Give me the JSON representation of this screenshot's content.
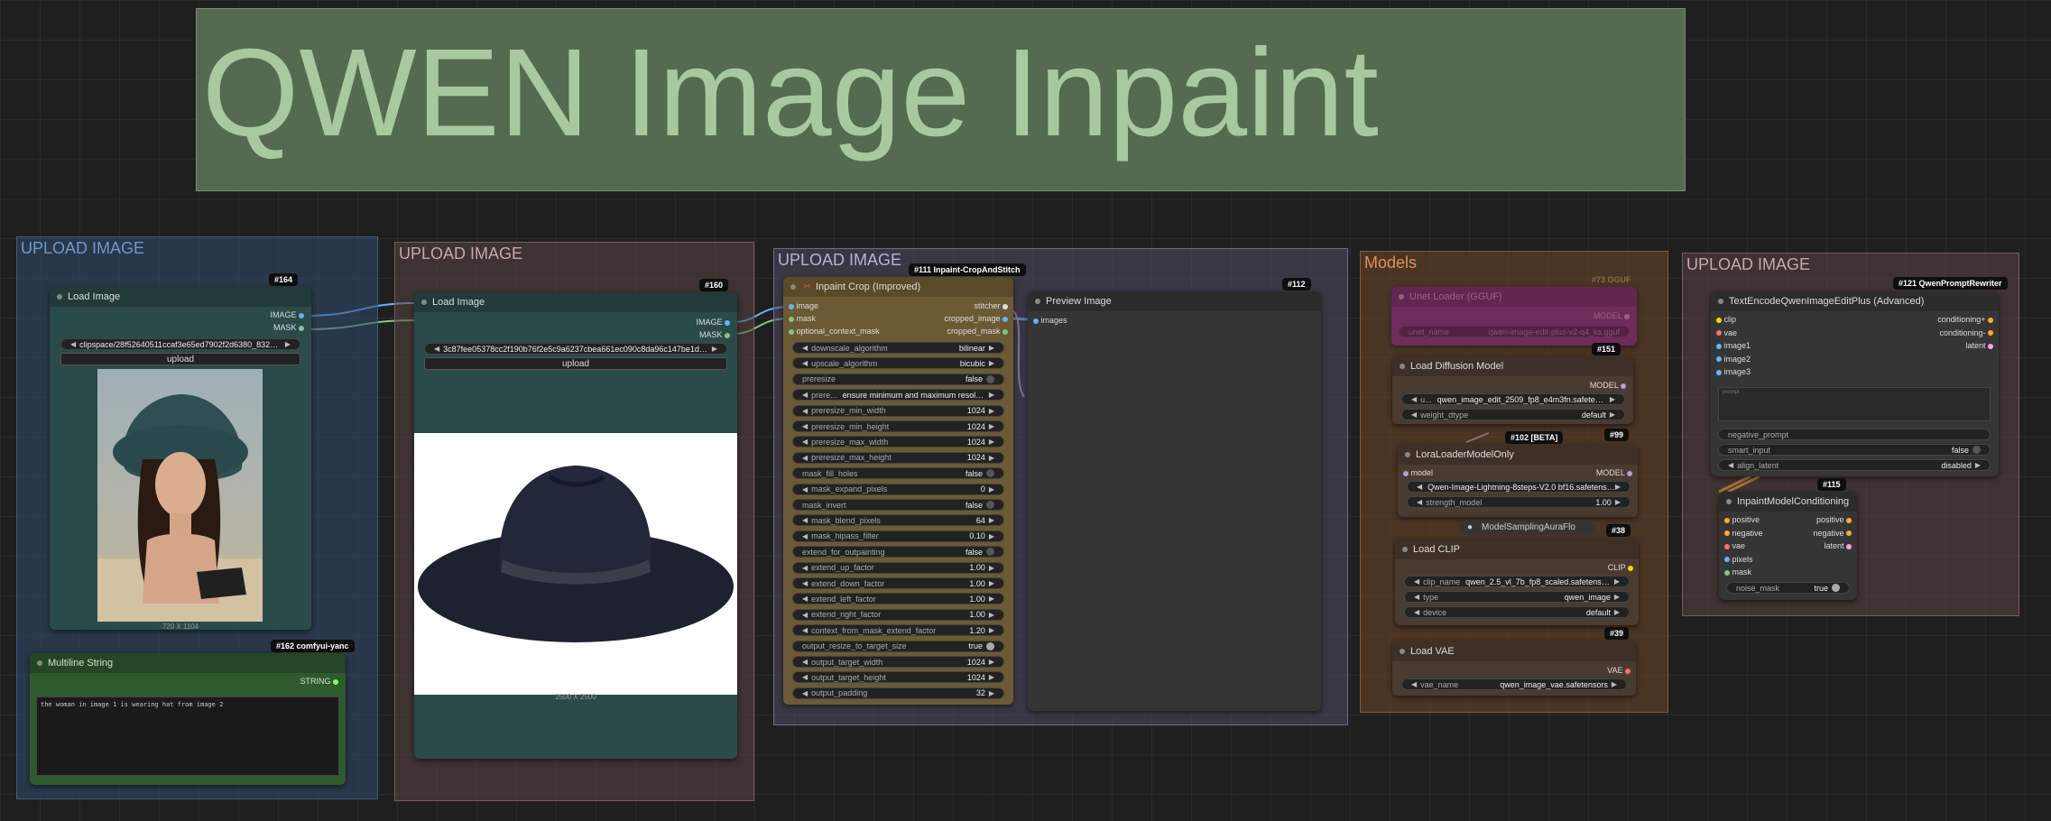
{
  "title_note": "QWEN Image Inpaint",
  "groups": {
    "g1": "UPLOAD IMAGE",
    "g2": "UPLOAD IMAGE",
    "g3": "UPLOAD IMAGE",
    "g4": "Models",
    "g5": "UPLOAD IMAGE"
  },
  "load_image_1": {
    "id": "#164",
    "title": "Load Image",
    "out_image": "IMAGE",
    "out_mask": "MASK",
    "file": "clipspace/28f52640511ccaf3e65ed7902f2d6380_8327c4 ...",
    "upload": "upload",
    "dims": "720 X 1104"
  },
  "multiline": {
    "id": "#162 comfyui-yanc",
    "title": "Multiline String",
    "out": "STRING",
    "text": "the woman in image 1 is wearing hat from image 2"
  },
  "load_image_2": {
    "id": "#160",
    "title": "Load Image",
    "out_image": "IMAGE",
    "out_mask": "MASK",
    "file": "3c87fee05378cc2f190b76f2e5c9a6237cbea661ec090c8da96c147be1d30d ...",
    "upload": "upload",
    "dims": "2500 X 2500"
  },
  "inpaint_crop": {
    "id": "#111 Inpaint-CropAndStitch",
    "title": "Inpaint Crop (Improved)",
    "in_image": "image",
    "in_mask": "mask",
    "in_ctx": "optional_context_mask",
    "out_stitcher": "stitcher",
    "out_cropped_image": "cropped_image",
    "out_cropped_mask": "cropped_mask",
    "widgets": [
      {
        "label": "downscale_algorithm",
        "value": "bilinear",
        "kind": "combo"
      },
      {
        "label": "upscale_algorithm",
        "value": "bicubic",
        "kind": "combo"
      },
      {
        "label": "preresize",
        "value": "false",
        "kind": "toggle"
      },
      {
        "label": "prere...",
        "value": "ensure minimum and maximum resolution",
        "kind": "combo"
      },
      {
        "label": "preresize_min_width",
        "value": "1024",
        "kind": "number"
      },
      {
        "label": "preresize_min_height",
        "value": "1024",
        "kind": "number"
      },
      {
        "label": "preresize_max_width",
        "value": "1024",
        "kind": "number"
      },
      {
        "label": "preresize_max_height",
        "value": "1024",
        "kind": "number"
      },
      {
        "label": "mask_fill_holes",
        "value": "false",
        "kind": "toggle"
      },
      {
        "label": "mask_expand_pixels",
        "value": "0",
        "kind": "number"
      },
      {
        "label": "mask_invert",
        "value": "false",
        "kind": "toggle"
      },
      {
        "label": "mask_blend_pixels",
        "value": "64",
        "kind": "number"
      },
      {
        "label": "mask_hipass_filter",
        "value": "0.10",
        "kind": "number"
      },
      {
        "label": "extend_for_outpainting",
        "value": "false",
        "kind": "toggle"
      },
      {
        "label": "extend_up_factor",
        "value": "1.00",
        "kind": "number"
      },
      {
        "label": "extend_down_factor",
        "value": "1.00",
        "kind": "number"
      },
      {
        "label": "extend_left_factor",
        "value": "1.00",
        "kind": "number"
      },
      {
        "label": "extend_right_factor",
        "value": "1.00",
        "kind": "number"
      },
      {
        "label": "context_from_mask_extend_factor",
        "value": "1.20",
        "kind": "number"
      },
      {
        "label": "output_resize_to_target_size",
        "value": "true",
        "kind": "toggle-on"
      },
      {
        "label": "output_target_width",
        "value": "1024",
        "kind": "number"
      },
      {
        "label": "output_target_height",
        "value": "1024",
        "kind": "number"
      },
      {
        "label": "output_padding",
        "value": "32",
        "kind": "number"
      }
    ]
  },
  "preview": {
    "id": "#112",
    "title": "Preview Image",
    "in_images": "images"
  },
  "unet_loader": {
    "id": "#73 GGUF",
    "title": "Unet Loader (GGUF)",
    "out": "MODEL",
    "w_label": "unet_name",
    "w_value": "qwen-image-edit-plus-v2-q4_ks.gguf"
  },
  "load_diffusion": {
    "id": "#151",
    "title": "Load Diffusion Model",
    "out": "MODEL",
    "w1_label": "u...",
    "w1_value": "qwen_image_edit_2509_fp8_e4m3fn.safetensors",
    "w2_label": "weight_dtype",
    "w2_value": "default"
  },
  "lora": {
    "id_beta": "#102 [BETA]",
    "id": "#99",
    "title": "LoraLoaderModelOnly",
    "in_model": "model",
    "out": "MODEL",
    "w1_value": "Qwen-Image-Lightning-8steps-V2.0 bf16.safetensors",
    "w2_label": "strength_model",
    "w2_value": "1.00"
  },
  "aura": {
    "title": "ModelSamplingAuraFlo",
    "id": "#38"
  },
  "load_clip": {
    "title": "Load CLIP",
    "out": "CLIP",
    "w1_label": "clip_name",
    "w1_value": "qwen_2.5_vl_7b_fp8_scaled.safetensors",
    "w2_label": "type",
    "w2_value": "qwen_image",
    "w3_label": "device",
    "w3_value": "default",
    "id": "#39"
  },
  "load_vae": {
    "title": "Load VAE",
    "out": "VAE",
    "w_label": "vae_name",
    "w_value": "qwen_image_vae.safetensors"
  },
  "text_encode": {
    "id": "#121 QwenPromptRewriter",
    "title": "TextEncodeQwenImageEditPlus (Advanced)",
    "inputs": [
      "clip",
      "vae",
      "image1",
      "image2",
      "image3"
    ],
    "outputs": [
      "conditioning+",
      "conditioning-",
      "latent"
    ],
    "prompt_placeholder": "prompt",
    "neg": "negative_prompt",
    "smart_label": "smart_input",
    "smart_value": "false",
    "align_label": "align_latent",
    "align_value": "disabled"
  },
  "inpaint_cond": {
    "id": "#115",
    "title": "InpaintModelConditioning",
    "inputs": [
      "positive",
      "negative",
      "vae",
      "pixels",
      "mask"
    ],
    "outputs": [
      "positive",
      "negative",
      "latent"
    ],
    "noise_label": "noise_mask",
    "noise_value": "true"
  },
  "colors": {
    "image": "#64b5f6",
    "mask": "#81c784",
    "model": "#b39ddb",
    "clip": "#ffd500",
    "vae": "#ff6e6e",
    "latent": "#ff9cf9",
    "conditioning": "#ffa931",
    "string": "#77ff77"
  }
}
